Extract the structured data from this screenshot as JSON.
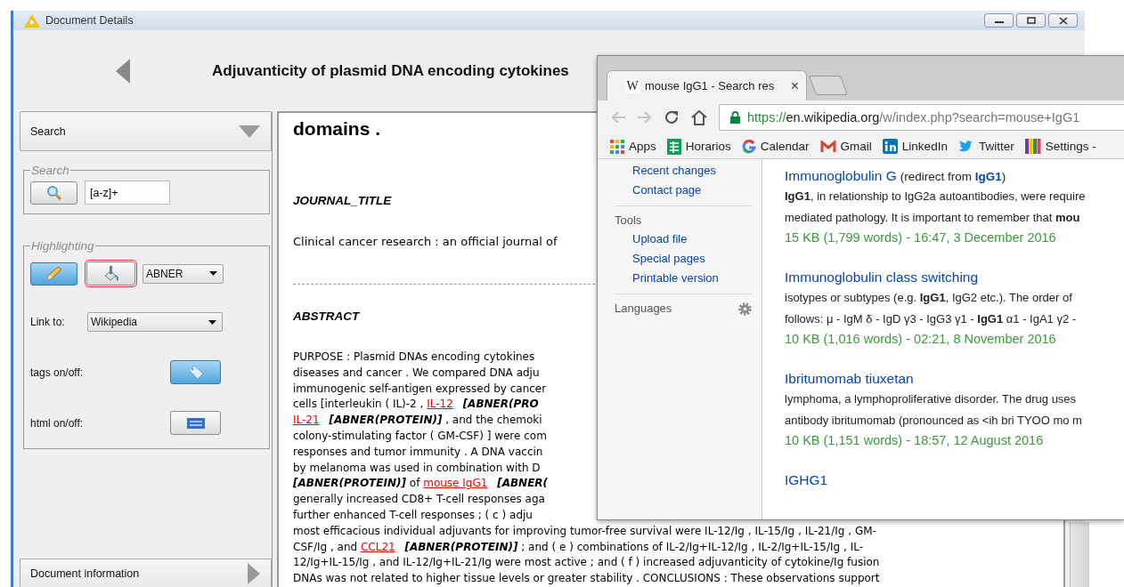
{
  "window": {
    "title": "Document Details"
  },
  "header": {
    "title": "Adjuvanticity of plasmid DNA encoding cytokines"
  },
  "sidebar": {
    "search_section": {
      "label": "Search",
      "expanded": true
    },
    "search_group": {
      "legend": "Search",
      "value": "[a-z]+"
    },
    "highlighting_group": {
      "legend": "Highlighting",
      "pencil_on": true,
      "brush_focused": true,
      "tagger": "ABNER",
      "link_label": "Link to:",
      "link_target": "Wikipedia",
      "toggles": [
        {
          "label": "tags on/off:",
          "kind": "tags",
          "on": true
        },
        {
          "label": "html on/off:",
          "kind": "html",
          "on": false
        }
      ]
    },
    "info_section": {
      "label": "Document information",
      "expanded": false
    }
  },
  "document": {
    "title_tail": "domains .",
    "journal_heading": "JOURNAL_TITLE",
    "journal": "Clinical cancer research : an official journal of",
    "abstract_heading": "ABSTRACT",
    "abstract_lines": [
      [
        {
          "kind": "text",
          "text": "PURPOSE : Plasmid DNAs encoding cytokines"
        }
      ],
      [
        {
          "kind": "text",
          "text": "diseases and cancer . We compared DNA adju"
        }
      ],
      [
        {
          "kind": "text",
          "text": "immunogenic self-antigen expressed by cancer"
        }
      ],
      [
        {
          "kind": "text",
          "text": "cells [interleukin ( IL)-2 , "
        },
        {
          "kind": "entity",
          "text": "IL-12"
        },
        {
          "kind": "tag",
          "text": "[ABNER(PRO"
        }
      ],
      [
        {
          "kind": "entity",
          "text": "IL-21"
        },
        {
          "kind": "tag",
          "text": "[ABNER(PROTEIN)]"
        },
        {
          "kind": "text",
          "text": " , and the chemoki"
        }
      ],
      [
        {
          "kind": "text",
          "text": "colony-stimulating factor ( GM-CSF) ] were com"
        }
      ],
      [
        {
          "kind": "text",
          "text": "responses and tumor immunity . A DNA vaccin"
        }
      ],
      [
        {
          "kind": "text",
          "text": "by melanoma was used in combination with D"
        }
      ],
      [
        {
          "kind": "tag",
          "text": "[ABNER(PROTEIN)]"
        },
        {
          "kind": "text",
          "text": " of "
        },
        {
          "kind": "entity",
          "text": "mouse IgG1"
        },
        {
          "kind": "tag",
          "text": "[ABNER("
        }
      ],
      [
        {
          "kind": "text",
          "text": "generally increased CD8+ T-cell responses aga"
        }
      ],
      [
        {
          "kind": "text",
          "text": "further enhanced T-cell responses ; ( c ) adju"
        }
      ],
      [
        {
          "kind": "text",
          "text": "most efficacious individual adjuvants for improving tumor-free survival were IL-12/Ig , IL-15/Ig , IL-21/Ig , GM-"
        }
      ],
      [
        {
          "kind": "text",
          "text": "CSF/Ig , and "
        },
        {
          "kind": "entity",
          "text": "CCL21"
        },
        {
          "kind": "tag",
          "text": "[ABNER(PROTEIN)]"
        },
        {
          "kind": "text",
          "text": " ; and ( e ) combinations of IL-2/Ig+IL-12/Ig , IL-2/Ig+IL-15/Ig , IL-"
        }
      ],
      [
        {
          "kind": "text",
          "text": "12/Ig+IL-15/Ig , and IL-12/Ig+IL-21/Ig were most active ; and ( f ) increased adjuvanticity of cytokine/Ig fusion"
        }
      ],
      [
        {
          "kind": "text",
          "text": "DNAs was not related to higher tissue levels or greater stability . CONCLUSIONS : These observations support"
        }
      ]
    ]
  },
  "browser": {
    "tabs": [
      {
        "favicon": "W",
        "title": "mouse IgG1 - Search res",
        "close": "×",
        "selected": true
      }
    ],
    "nav": {
      "back_disabled": true,
      "forward_disabled": true
    },
    "url": {
      "scheme": "https://",
      "host": "en.wikipedia.org",
      "path": "/w/index.php?search=mouse+IgG1"
    },
    "bookmarks": [
      {
        "kind": "apps",
        "label": "Apps"
      },
      {
        "kind": "sheet",
        "label": "Horarios"
      },
      {
        "kind": "google",
        "label": "Calendar"
      },
      {
        "kind": "mail",
        "label": "Gmail"
      },
      {
        "kind": "linkedin",
        "label": "LinkedIn"
      },
      {
        "kind": "bird",
        "label": "Twitter"
      },
      {
        "kind": "stripes",
        "label": "Settings -"
      }
    ],
    "sidebar": {
      "links": [
        "Recent changes",
        "Contact page"
      ],
      "tools_heading": "Tools",
      "tools": [
        "Upload file",
        "Special pages",
        "Printable version"
      ],
      "languages_heading": "Languages"
    },
    "results": [
      {
        "title": "Immunoglobulin G",
        "redirect": "(redirect from **IgG1**)",
        "snippet": [
          "**IgG1**, in relationship to IgG2a autoantibodies, were require",
          "mediated pathology. It is important to remember that **mou**"
        ],
        "meta": "15 KB (1,799 words) - 16:47, 3 December 2016"
      },
      {
        "title": "Immunoglobulin class switching",
        "snippet": [
          "isotypes or subtypes (e.g. **IgG1**, IgG2 etc.). The order of",
          "follows: μ - IgM δ - IgD γ3 - IgG3 γ1 - **IgG1** α1 - IgA1 γ2 -"
        ],
        "meta": "10 KB (1,016 words) - 02:21, 8 November 2016"
      },
      {
        "title": "Ibritumomab tiuxetan",
        "snippet": [
          "lymphoma, a lymphoproliferative disorder. The drug uses",
          "antibody ibritumomab (pronounced as <ih bri TYOO mo m"
        ],
        "meta": "10 KB (1,151 words) - 18:57, 12 August 2016"
      },
      {
        "title": "IGHG1"
      }
    ]
  }
}
